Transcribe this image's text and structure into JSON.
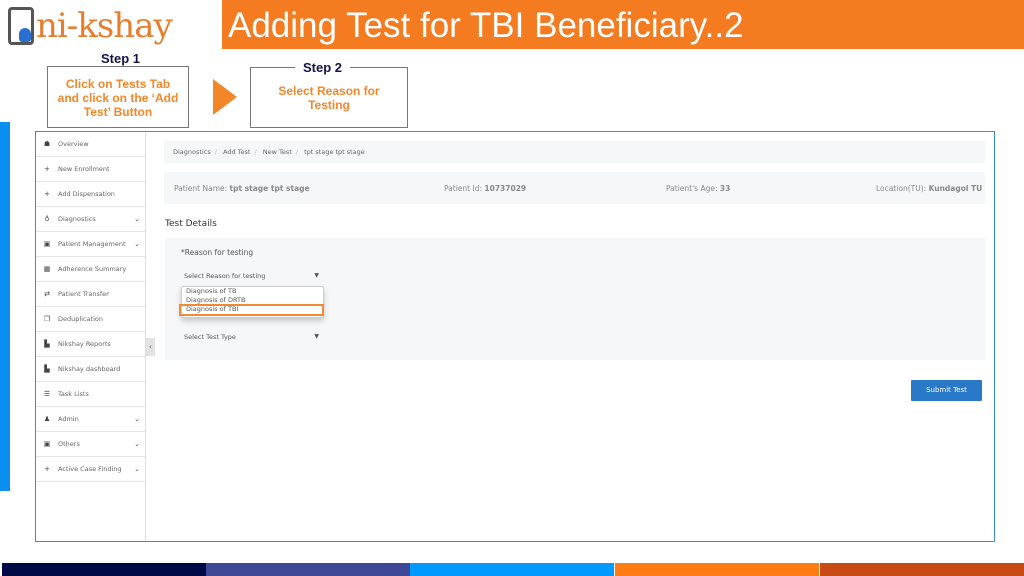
{
  "logo": {
    "text": "ni-kshay"
  },
  "title": "Adding Test for TBI Beneficiary..2",
  "steps": [
    {
      "label": "Step 1",
      "text": "Click on Tests Tab and click on the ‘Add Test’ Button"
    },
    {
      "label": "Step 2",
      "text": "Select Reason for Testing"
    }
  ],
  "sidebar": {
    "items": [
      {
        "label": "Overview",
        "icon": "dashboard-icon",
        "glyph": "☗",
        "chevron": false
      },
      {
        "label": "New Enrollment",
        "icon": "plus-icon",
        "glyph": "+",
        "chevron": false
      },
      {
        "label": "Add Dispensation",
        "icon": "plus-icon",
        "glyph": "+",
        "chevron": false
      },
      {
        "label": "Diagnostics",
        "icon": "stethoscope-icon",
        "glyph": "♁",
        "chevron": true
      },
      {
        "label": "Patient Management",
        "icon": "briefcase-icon",
        "glyph": "▣",
        "chevron": true
      },
      {
        "label": "Adherence Summary",
        "icon": "calendar-icon",
        "glyph": "▦",
        "chevron": false
      },
      {
        "label": "Patient Transfer",
        "icon": "transfer-icon",
        "glyph": "⇄",
        "chevron": false
      },
      {
        "label": "Deduplication",
        "icon": "copy-icon",
        "glyph": "❐",
        "chevron": false
      },
      {
        "label": "Nikshay Reports",
        "icon": "file-icon",
        "glyph": "▙",
        "chevron": false
      },
      {
        "label": "Nikshay dashboard",
        "icon": "file-icon",
        "glyph": "▙",
        "chevron": false
      },
      {
        "label": "Task Lists",
        "icon": "list-icon",
        "glyph": "☰",
        "chevron": false
      },
      {
        "label": "Admin",
        "icon": "user-icon",
        "glyph": "♟",
        "chevron": true
      },
      {
        "label": "Others",
        "icon": "briefcase-icon",
        "glyph": "▣",
        "chevron": true
      },
      {
        "label": "Active Case Finding",
        "icon": "plus-icon",
        "glyph": "+",
        "chevron": true
      }
    ]
  },
  "breadcrumb": [
    "Diagnostics",
    "Add Test",
    "New Test",
    "tpt stage tpt stage"
  ],
  "patient": {
    "name_label": "Patient Name:",
    "name": "tpt stage tpt stage",
    "id_label": "Patient Id:",
    "id": "10737029",
    "age_label": "Patient's Age:",
    "age": "33",
    "location_label": "Location(TU):",
    "location": "Kundagol TU"
  },
  "test_details": {
    "heading": "Test Details",
    "reason_label": "*Reason for testing",
    "reason_placeholder": "Select Reason for testing",
    "reason_options": [
      "Diagnosis of TB",
      "Diagnosis of DRTB",
      "Diagnosis of TBI"
    ],
    "highlighted_option": "Diagnosis of TBI",
    "test_type_placeholder": "Select Test Type"
  },
  "submit_label": "Submit Test",
  "colors": {
    "accent": "#f47b20",
    "button": "#2a78c8",
    "bottom_bar": [
      "#000a45",
      "#3f4797",
      "#0099ff",
      "#ff7b14",
      "#c84b16"
    ]
  }
}
